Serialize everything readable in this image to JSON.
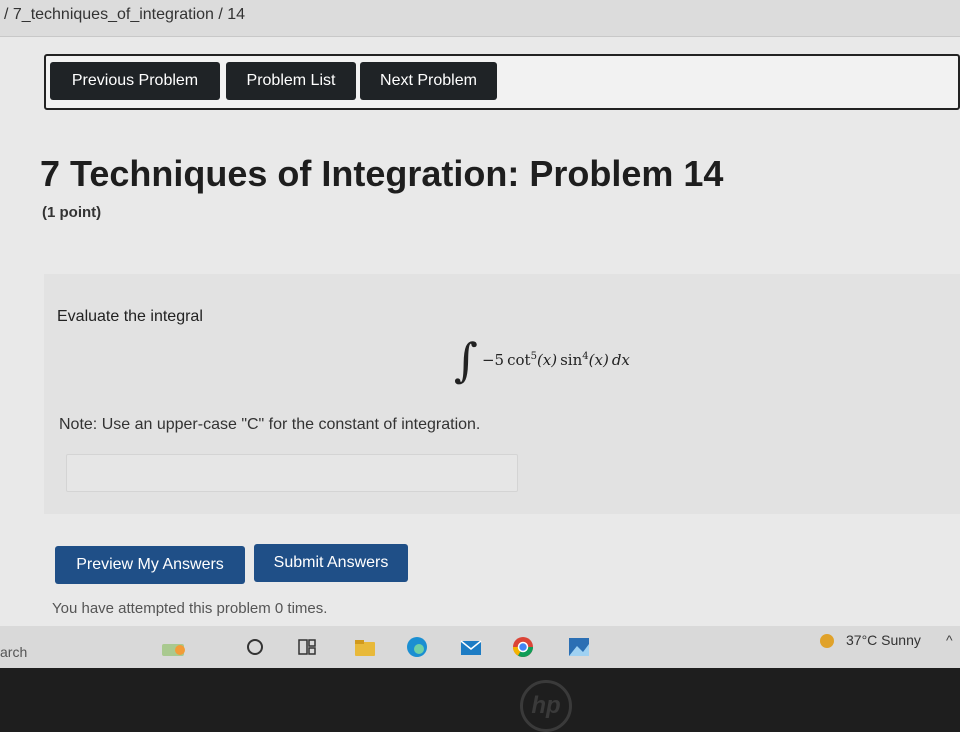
{
  "breadcrumb": "/ 7_techniques_of_integration / 14",
  "nav": {
    "previous": "Previous Problem",
    "list": "Problem List",
    "next": "Next Problem"
  },
  "problem": {
    "title": "7 Techniques of Integration: Problem 14",
    "points": "(1 point)",
    "prompt": "Evaluate the integral",
    "integral_sign": "∫",
    "coefficient": "−5",
    "function1": "cot",
    "exponent1": "5",
    "function2": "sin",
    "exponent2": "4",
    "argument": "(x)",
    "differential": "dx",
    "note": "Note: Use an upper-case \"C\" for the constant of integration.",
    "answer_value": ""
  },
  "actions": {
    "preview": "Preview My Answers",
    "submit": "Submit Answers"
  },
  "attempts_text": "You have attempted this problem 0 times.",
  "taskbar": {
    "search_partial": "arch",
    "weather": "37°C  Sunny",
    "tray_icon": "^",
    "brand": "hp",
    "pinned_icons": [
      "widgets-icon",
      "task-view-icon",
      "file-explorer-icon",
      "edge-icon",
      "mail-icon",
      "chrome-icon",
      "photos-icon"
    ]
  }
}
